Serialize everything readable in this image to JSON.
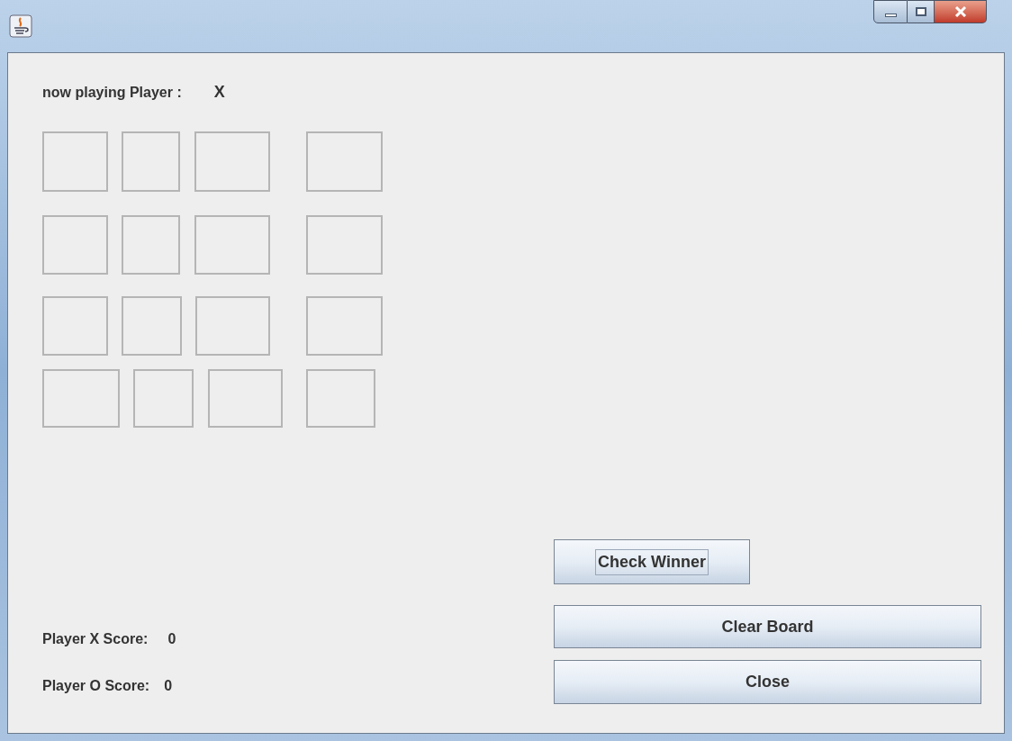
{
  "turn": {
    "label": "now playing Player :",
    "player": "X"
  },
  "scores": [
    {
      "label": "Player X Score:",
      "value": "0"
    },
    {
      "label": "Player O Score:",
      "value": "0"
    }
  ],
  "buttons": {
    "check": "Check Winner",
    "clear": "Clear Board",
    "close": "Close"
  }
}
